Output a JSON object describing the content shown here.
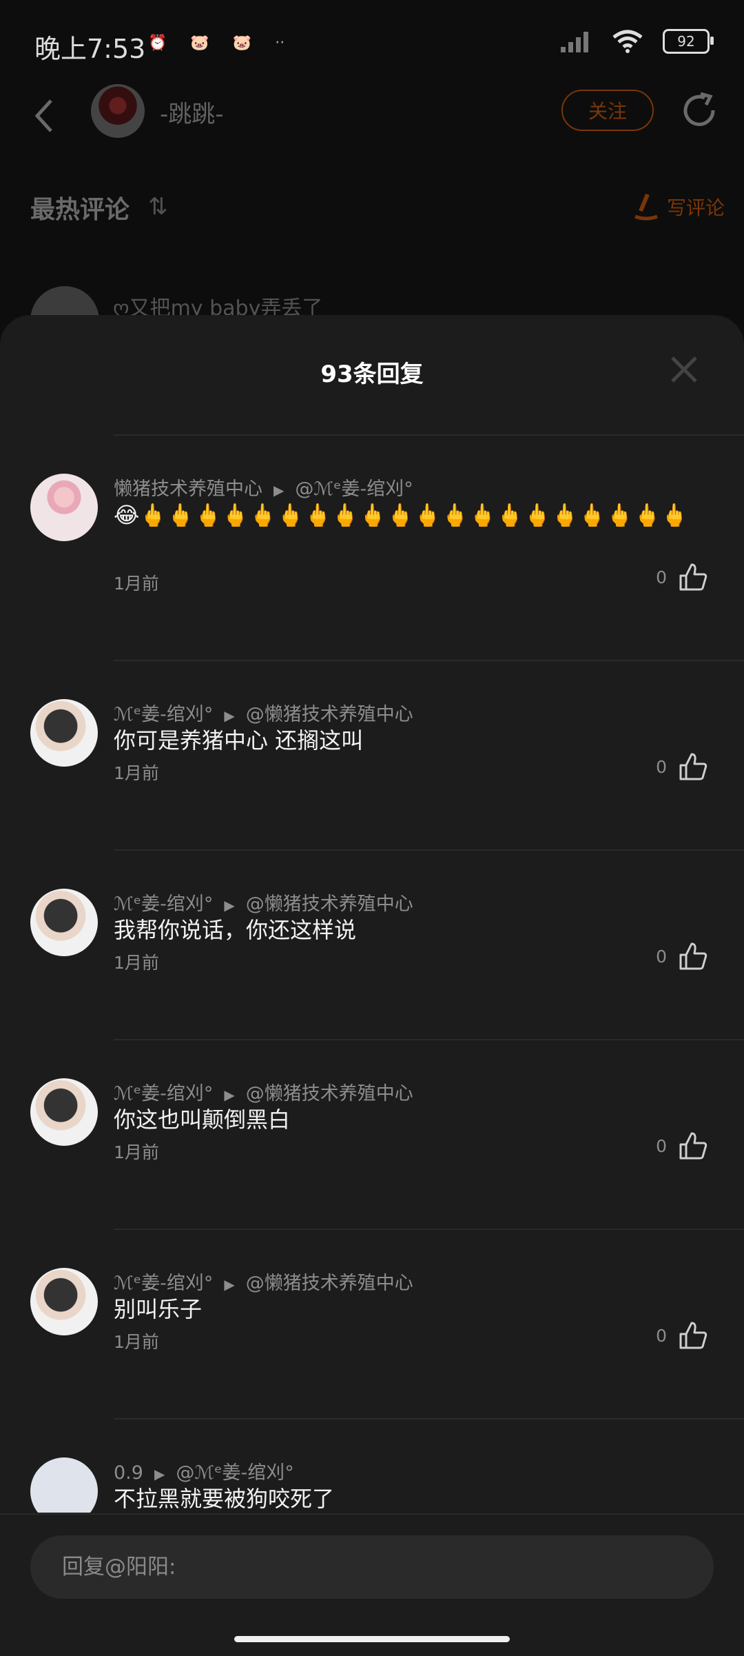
{
  "status_bar": {
    "time": "晚上7:53",
    "notification_icons": [
      "⏰",
      "🐷",
      "🐷",
      "··"
    ],
    "battery": "92"
  },
  "header": {
    "author_name": "-跳跳-",
    "follow_label": "关注"
  },
  "comments_section": {
    "title": "最热评论",
    "sort_icon": "⇅",
    "write_label": "写评论",
    "peek_comment": "ღ又把my baby弄丢了"
  },
  "sheet": {
    "title": "93条回复",
    "replies": [
      {
        "user": "懒猪技术养殖中心",
        "target": "@ℳᵉ姜-绾刈°",
        "text": "😂🖕🖕🖕🖕🖕🖕🖕🖕🖕🖕🖕🖕🖕🖕🖕🖕🖕🖕🖕🖕",
        "time": "1月前",
        "likes": "0"
      },
      {
        "user": "ℳᵉ姜-绾刈°",
        "target": "@懒猪技术养殖中心",
        "text": "你可是养猪中心 还搁这叫",
        "time": "1月前",
        "likes": "0"
      },
      {
        "user": "ℳᵉ姜-绾刈°",
        "target": "@懒猪技术养殖中心",
        "text": "我帮你说话，你还这样说",
        "time": "1月前",
        "likes": "0"
      },
      {
        "user": "ℳᵉ姜-绾刈°",
        "target": "@懒猪技术养殖中心",
        "text": "你这也叫颠倒黑白",
        "time": "1月前",
        "likes": "0"
      },
      {
        "user": "ℳᵉ姜-绾刈°",
        "target": "@懒猪技术养殖中心",
        "text": "别叫乐子",
        "time": "1月前",
        "likes": "0"
      },
      {
        "user": "0.9",
        "target": "@ℳᵉ姜-绾刈°",
        "text": "不拉黑就要被狗咬死了",
        "time": "",
        "likes": ""
      }
    ]
  },
  "input": {
    "placeholder": "回复@阳阳:"
  }
}
